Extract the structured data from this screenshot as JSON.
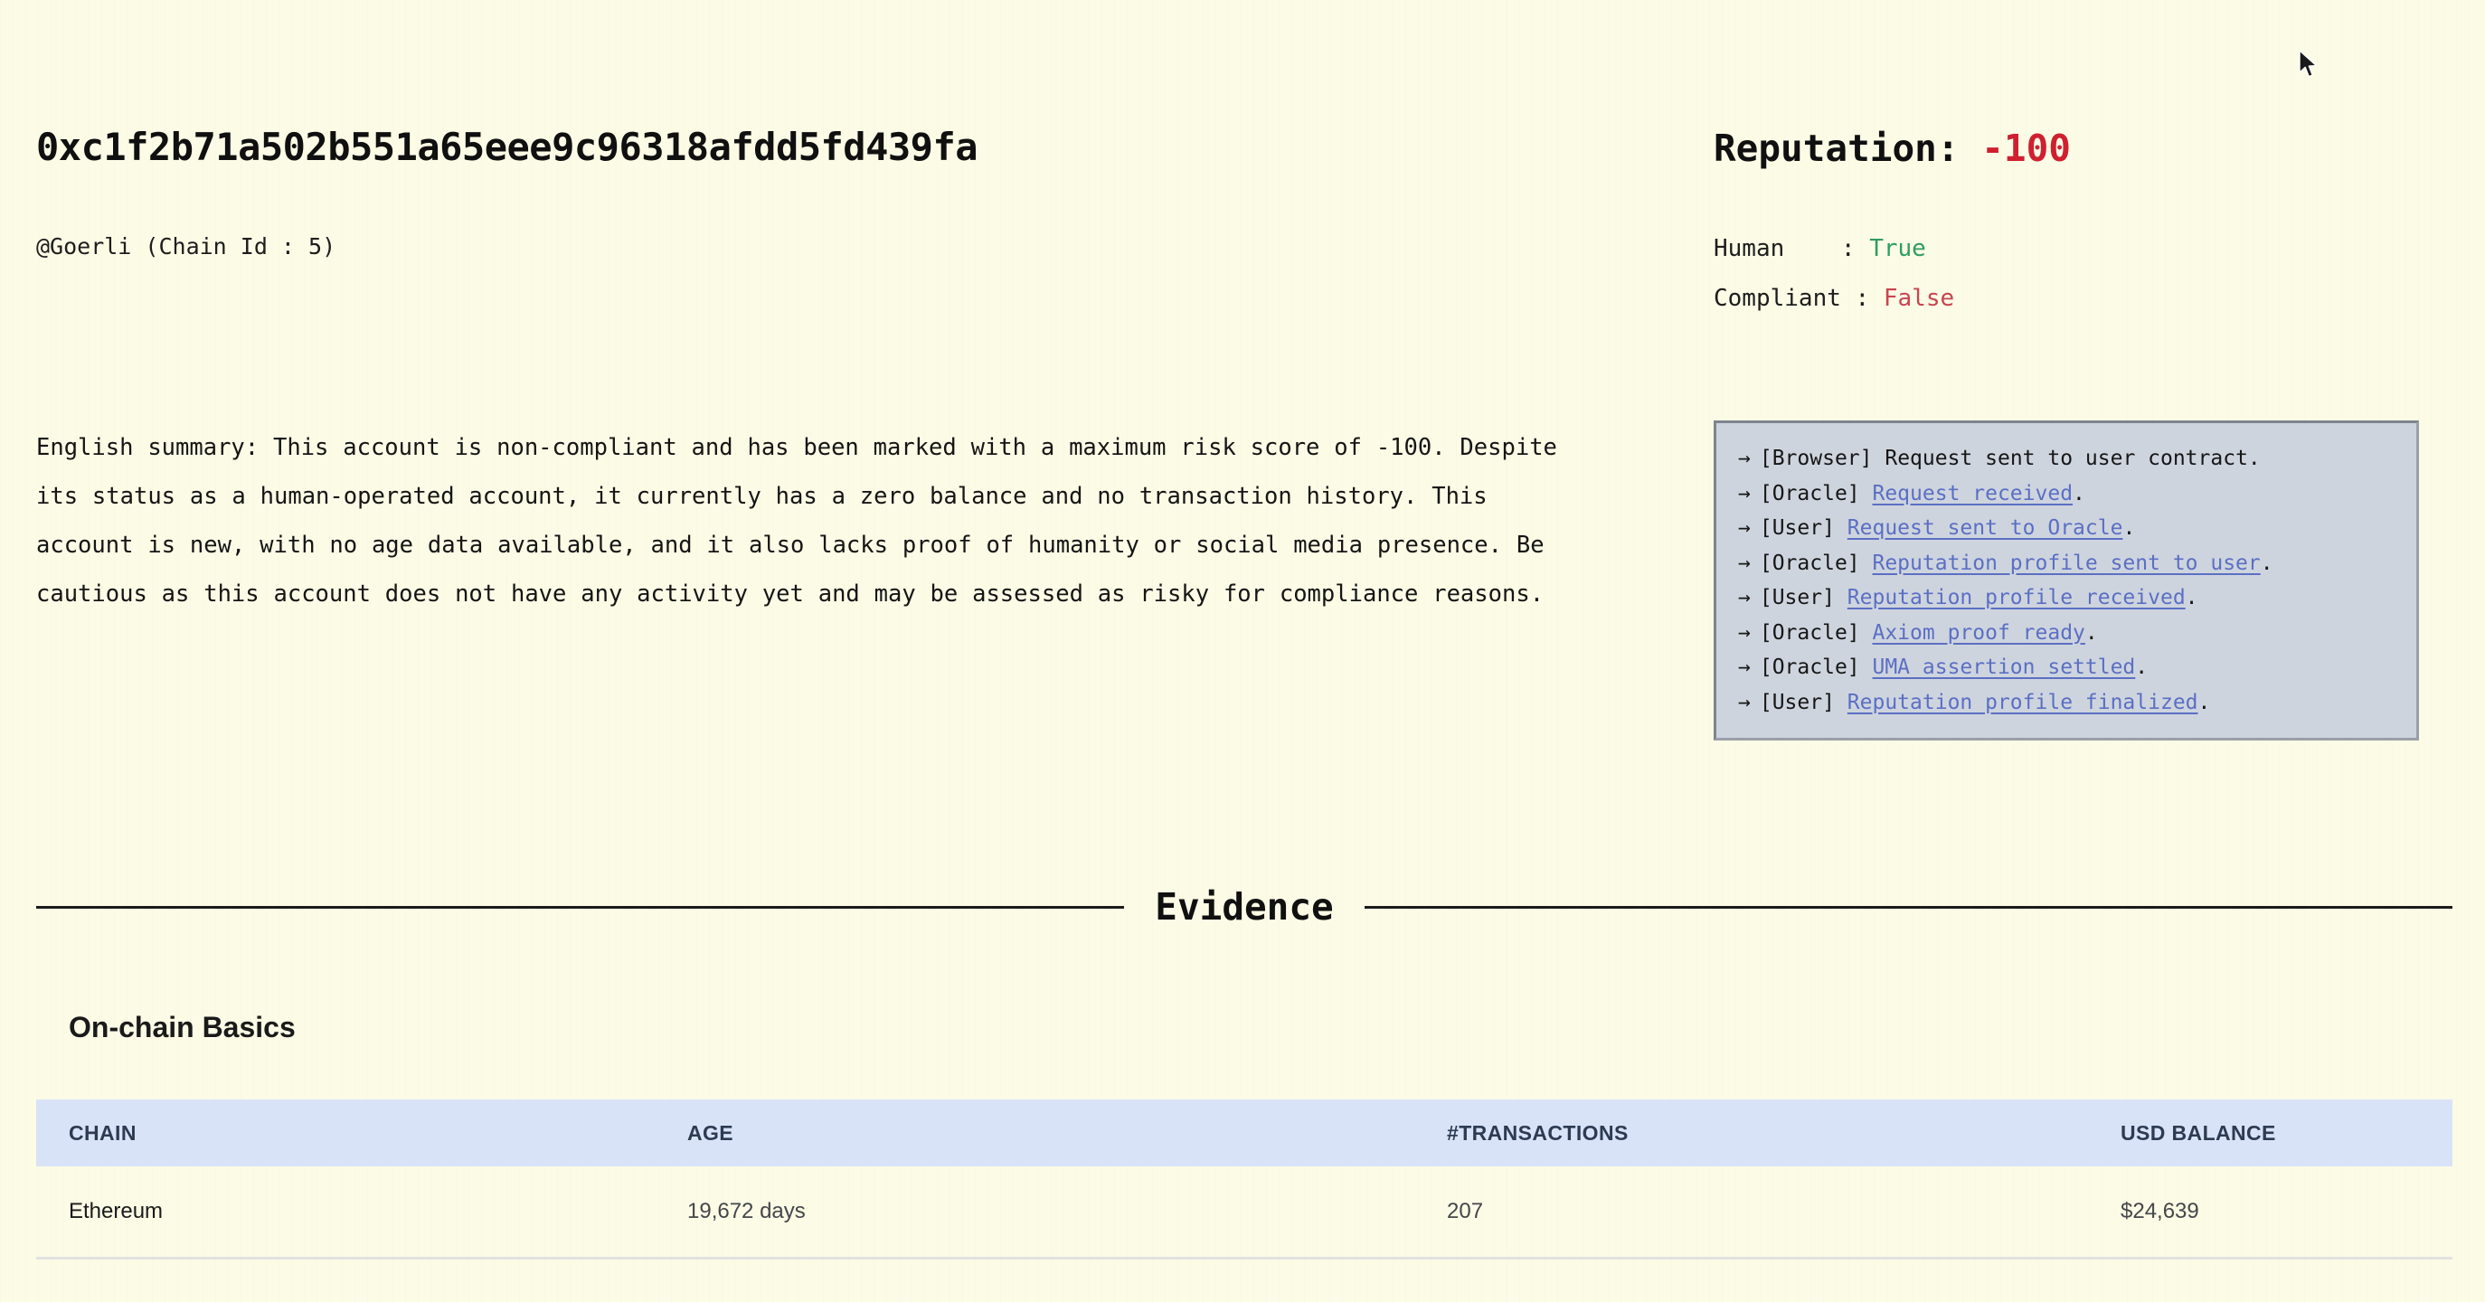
{
  "account": {
    "address": "0xc1f2b71a502b551a65eee9c96318afdd5fd439fa",
    "chain_line": "@Goerli (Chain Id : 5)",
    "summary": "English summary: This account is non-compliant and has been marked with a maximum risk score of -100. Despite its status as a human-operated account, it currently has a zero balance and no transaction history. This account is new, with no age data available, and it also lacks proof of humanity or social media presence. Be cautious as this account does not have any activity yet and may be assessed as risky for compliance reasons."
  },
  "reputation": {
    "label": "Reputation:",
    "score": "-100",
    "score_color": "#cf2030",
    "human_key": "Human",
    "human_sep": "    : ",
    "human_value": "True",
    "human_value_color": "#2f9e5e",
    "compliant_key": "Compliant",
    "compliant_sep": " : ",
    "compliant_value": "False",
    "compliant_value_color": "#c8454f"
  },
  "log": {
    "arrow": "→",
    "link_color": "#5b6fc4",
    "entries": [
      {
        "actor": "[Browser]",
        "text": "Request sent to user contract",
        "link": false,
        "period": "."
      },
      {
        "actor": "[Oracle]",
        "text": "Request received",
        "link": true,
        "period": "."
      },
      {
        "actor": "[User]",
        "text": "Request sent to Oracle",
        "link": true,
        "period": "."
      },
      {
        "actor": "[Oracle]",
        "text": "Reputation profile sent to user",
        "link": true,
        "period": "."
      },
      {
        "actor": "[User]",
        "text": "Reputation profile received",
        "link": true,
        "period": "."
      },
      {
        "actor": "[Oracle]",
        "text": "Axiom proof ready",
        "link": true,
        "period": "."
      },
      {
        "actor": "[Oracle]",
        "text": "UMA assertion settled",
        "link": true,
        "period": "."
      },
      {
        "actor": "[User]",
        "text": "Reputation profile finalized",
        "link": true,
        "period": "."
      }
    ]
  },
  "evidence": {
    "title": "Evidence"
  },
  "onchain_basics": {
    "title": "On-chain Basics",
    "columns": [
      "CHAIN",
      "AGE",
      "#TRANSACTIONS",
      "USD BALANCE"
    ],
    "rows": [
      {
        "chain": "Ethereum",
        "age": "19,672 days",
        "transactions": "207",
        "usd_balance": "$24,639"
      }
    ]
  },
  "theme": {
    "background": "#fbfbe6",
    "log_background": "#ced4de",
    "table_header_background": "#d9e3f8",
    "table_header_text": "#2d3b52"
  },
  "cursor": {
    "icon": "mouse-pointer"
  }
}
